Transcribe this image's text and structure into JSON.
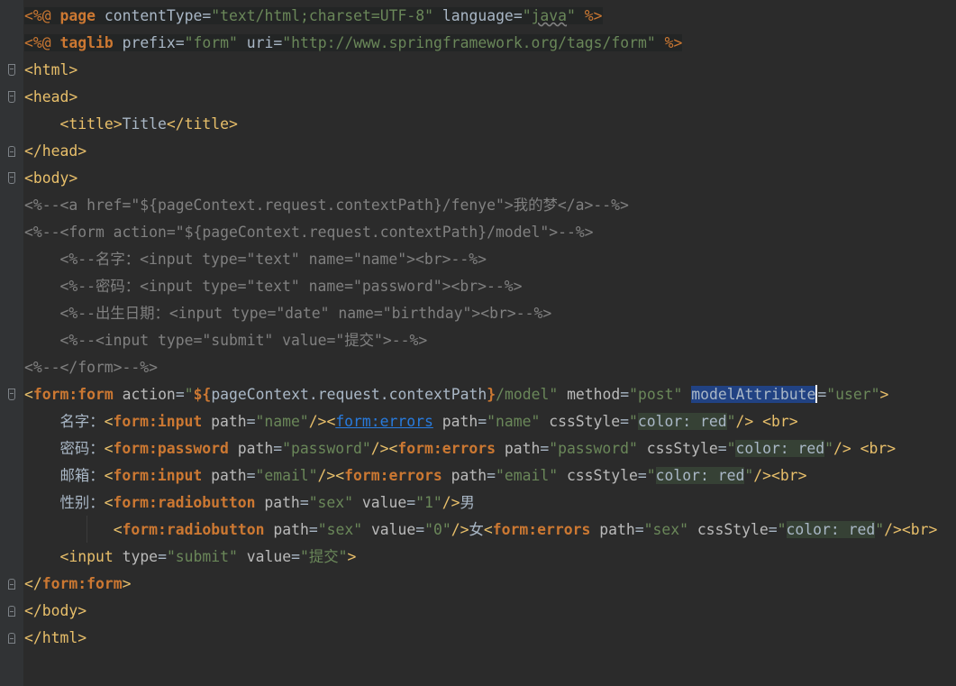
{
  "editor": {
    "language": "JSP",
    "lines": [
      "<%@ page contentType=\"text/html;charset=UTF-8\" language=\"java\" %>",
      "<%@ taglib prefix=\"form\" uri=\"http://www.springframework.org/tags/form\" %>",
      "<html>",
      "<head>",
      "    <title>Title</title>",
      "</head>",
      "<body>",
      "<%--<a href=\"${pageContext.request.contextPath}/fenye\">我的梦</a>--%>",
      "<%--<form action=\"${pageContext.request.contextPath}/model\">--%>",
      "    <%--名字：<input type=\"text\" name=\"name\"><br>--%>",
      "    <%--密码：<input type=\"text\" name=\"password\"><br>--%>",
      "    <%--出生日期：<input type=\"date\" name=\"birthday\"><br>--%>",
      "    <%--<input type=\"submit\" value=\"提交\">--%>",
      "<%--</form>--%>",
      "<form:form action=\"${pageContext.request.contextPath}/model\" method=\"post\" modelAttribute=\"user\">",
      "    名字：<form:input path=\"name\"/><form:errors path=\"name\" cssStyle=\"color: red\"/> <br>",
      "    密码：<form:password path=\"password\"/><form:errors path=\"password\" cssStyle=\"color: red\"/> <br>",
      "    邮箱：<form:input path=\"email\"/><form:errors path=\"email\" cssStyle=\"color: red\"/><br>",
      "    性别：<form:radiobutton path=\"sex\" value=\"1\"/>男",
      "          <form:radiobutton path=\"sex\" value=\"0\"/>女<form:errors path=\"sex\" cssStyle=\"color: red\"/><br>",
      "    <input type=\"submit\" value=\"提交\">",
      "</form:form>",
      "</body>",
      "</html>"
    ],
    "colors": {
      "background": "#2b2b2b",
      "gutter": "#313335",
      "tag": "#e8bf6a",
      "keyword": "#cc7832",
      "string": "#6a8759",
      "comment": "#808080",
      "attribute": "#bababa",
      "text": "#a9b7c6",
      "selection": "#214283",
      "css_inline_bg": "#364135"
    }
  }
}
